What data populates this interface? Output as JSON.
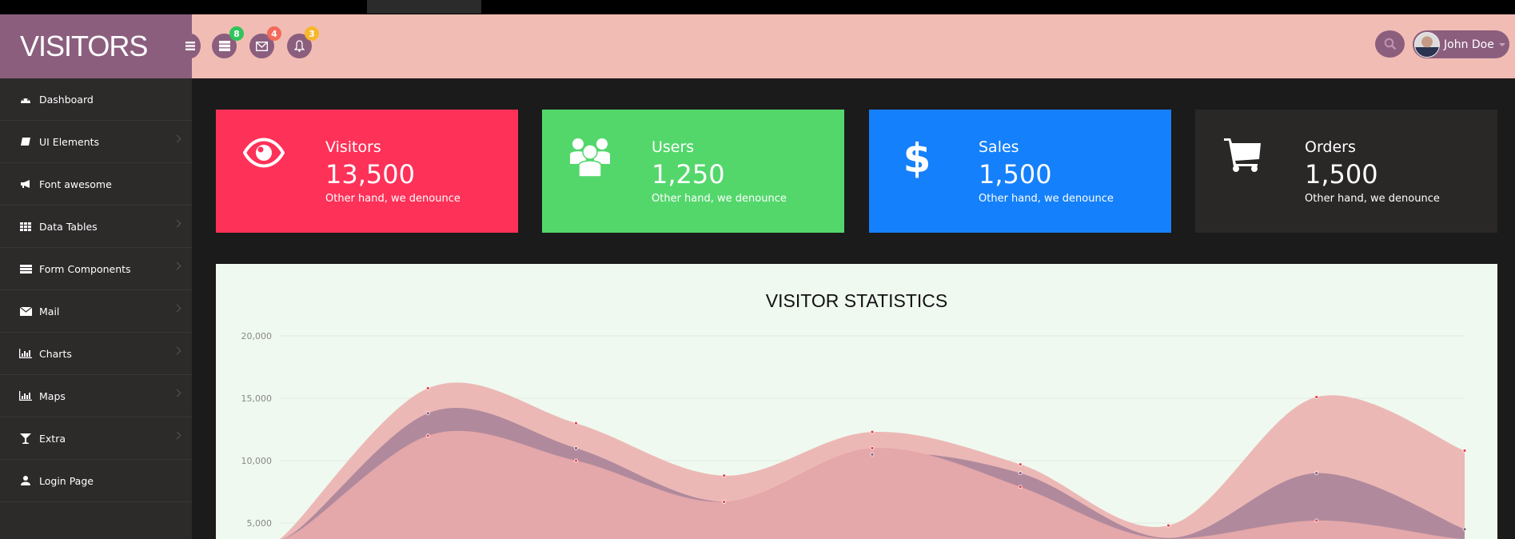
{
  "header": {
    "brand": "VISITORS",
    "badges": {
      "tasks": "8",
      "messages": "4",
      "notifications": "3"
    },
    "badge_colors": {
      "tasks": "#2fc55a",
      "messages": "#f36a5a",
      "notifications": "#f7b62c"
    },
    "user": "John Doe"
  },
  "sidebar": {
    "items": [
      {
        "label": "Dashboard",
        "icon": "dashboard-icon",
        "chevron": false
      },
      {
        "label": "UI Elements",
        "icon": "book-icon",
        "chevron": true
      },
      {
        "label": "Font awesome",
        "icon": "bullhorn-icon",
        "chevron": false
      },
      {
        "label": "Data Tables",
        "icon": "table-icon",
        "chevron": true
      },
      {
        "label": "Form Components",
        "icon": "form-icon",
        "chevron": true
      },
      {
        "label": "Mail",
        "icon": "envelope-icon",
        "chevron": true
      },
      {
        "label": "Charts",
        "icon": "bar-chart-icon",
        "chevron": true
      },
      {
        "label": "Maps",
        "icon": "bar-chart-icon",
        "chevron": true
      },
      {
        "label": "Extra",
        "icon": "glass-icon",
        "chevron": true
      },
      {
        "label": "Login Page",
        "icon": "user-icon",
        "chevron": false
      }
    ]
  },
  "cards": [
    {
      "title": "Visitors",
      "value": "13,500",
      "desc": "Other hand, we denounce",
      "icon": "eye-icon",
      "color": "#fe3158"
    },
    {
      "title": "Users",
      "value": "1,250",
      "desc": "Other hand, we denounce",
      "icon": "users-icon",
      "color": "#53d76b"
    },
    {
      "title": "Sales",
      "value": "1,500",
      "desc": "Other hand, we denounce",
      "icon": "dollar-icon",
      "color": "#1580fb"
    },
    {
      "title": "Orders",
      "value": "1,500",
      "desc": "Other hand, we denounce",
      "icon": "cart-icon",
      "color": "#2a2827"
    }
  ],
  "chart_data": {
    "type": "area",
    "title": "VISITOR STATISTICS",
    "yticks": [
      "5,000",
      "10,000",
      "15,000",
      "20,000"
    ],
    "ylim": [
      0,
      20000
    ],
    "grid": true,
    "series": [
      {
        "color": "#ecb8b6",
        "values": [
          3000,
          15800,
          13000,
          8800,
          12300,
          9700,
          4800,
          15100,
          10800
        ]
      },
      {
        "color": "#b08a9c",
        "values": [
          1500,
          13800,
          11000,
          6700,
          10500,
          9000,
          3800,
          9000,
          4500
        ]
      },
      {
        "color": "#e4a7aa",
        "values": [
          2000,
          12000,
          10000,
          6700,
          11000,
          7900,
          2500,
          5200,
          3000
        ]
      }
    ]
  }
}
